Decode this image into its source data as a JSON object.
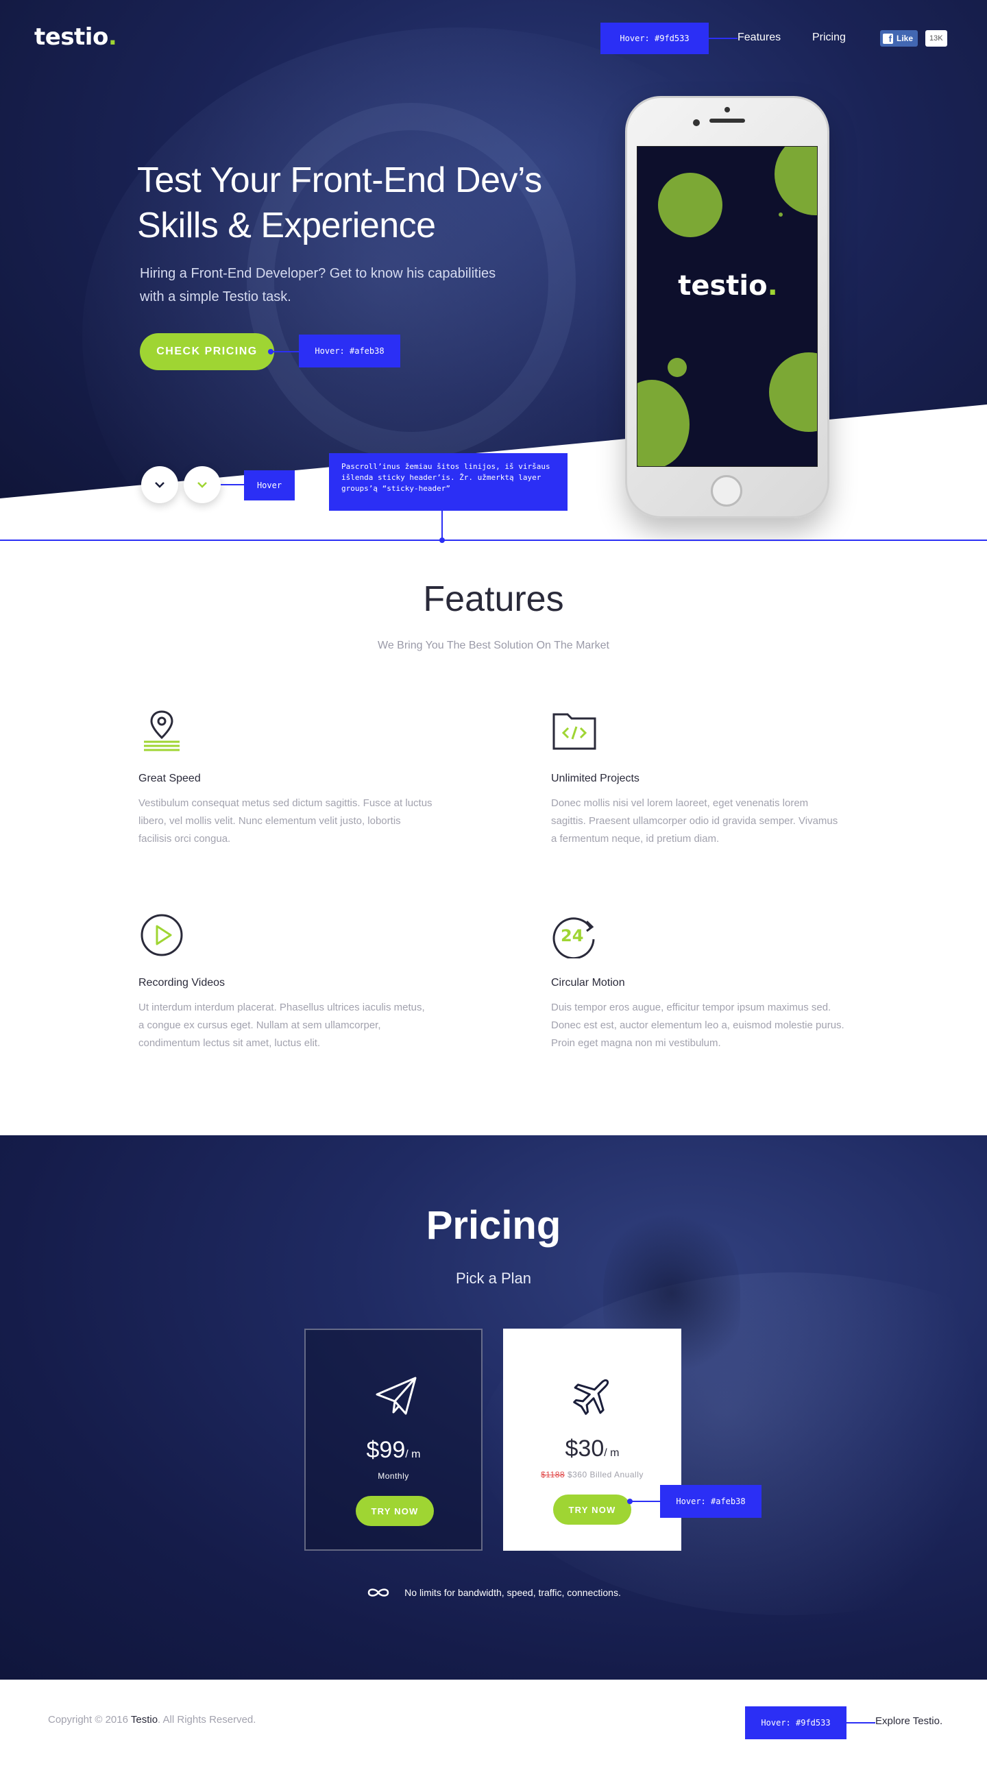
{
  "brand": {
    "name": "testio",
    "dot": "."
  },
  "nav": {
    "hover_note": "Hover: #9fd533",
    "features": "Features",
    "pricing": "Pricing",
    "like_label": "Like",
    "like_count": "13K"
  },
  "hero": {
    "title_line1": "Test Your Front-End Dev’s",
    "title_line2": "Skills & Experience",
    "subtitle_line1": "Hiring a Front-End Developer? Get to know his capabilities",
    "subtitle_line2": "with a simple Testio task.",
    "cta_label": "CHECK PRICING",
    "cta_hover_note": "Hover: #afeb38",
    "scroll_hover_note": "Hover",
    "sticky_note": "Pascroll’inus žemiau šitos linijos, iš viršaus išlenda sticky header’is. Žr. užmerktą layer groups’ą “sticky-header”"
  },
  "features": {
    "title": "Features",
    "subtitle": "We Bring You The Best Solution On The Market",
    "items": [
      {
        "icon": "location-pin-icon",
        "name": "Great Speed",
        "description": "Vestibulum consequat metus sed dictum sagittis. Fusce at luctus libero, vel mollis velit. Nunc elementum velit justo, lobortis facilisis orci congua."
      },
      {
        "icon": "code-folder-icon",
        "name": "Unlimited Projects",
        "description": "Donec mollis nisi vel lorem laoreet, eget venenatis lorem sagittis. Praesent ullamcorper odio id gravida semper. Vivamus a fermentum neque, id pretium diam."
      },
      {
        "icon": "play-circle-icon",
        "name": "Recording Videos",
        "description": "Ut interdum interdum placerat. Phasellus ultrices iaculis metus, a congue ex cursus eget. Nullam at sem ullamcorper, condimentum lectus sit amet, luctus elit."
      },
      {
        "icon": "clock-24-icon",
        "name": "Circular Motion",
        "description": "Duis tempor eros augue, efficitur tempor ipsum maximus sed. Donec est est, auctor elementum leo a, euismod molestie purus. Proin eget magna non mi vestibulum."
      }
    ]
  },
  "pricing": {
    "title": "Pricing",
    "subtitle": "Pick a Plan",
    "plans": [
      {
        "icon": "paper-plane-icon",
        "price": "$99",
        "per": "/ m",
        "note": "Monthly",
        "old_price": "",
        "button": "TRY NOW"
      },
      {
        "icon": "airplane-icon",
        "price": "$30",
        "per": "/ m",
        "note": "$360 Billed Anually",
        "old_price": "$1188",
        "button": "TRY NOW"
      }
    ],
    "button_hover_note": "Hover: #afeb38",
    "footnote": "No limits for bandwidth, speed, traffic, connections."
  },
  "footer": {
    "copyright_prefix": "Copyright © 2016",
    "brand": "Testio",
    "copyright_suffix": ". All Rights Reserved.",
    "hover_note": "Hover: #9fd533",
    "link": "Explore Testio."
  },
  "colors": {
    "accent_green": "#9fd533",
    "hover_green": "#afeb38",
    "annotation_blue": "#2b2ff5",
    "navy": "#1a2356"
  }
}
